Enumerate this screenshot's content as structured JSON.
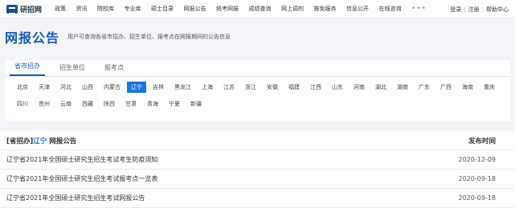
{
  "site": {
    "logo_text": "研招网"
  },
  "nav": {
    "items": [
      "政策",
      "资讯",
      "院校库",
      "专业库",
      "硕士目录",
      "网报公告",
      "统考网报",
      "成绩查询",
      "网上调剂",
      "推免服务",
      "信息公开",
      "在线咨询"
    ],
    "more": "•••"
  },
  "toplinks": {
    "login": "登录",
    "register": "注册",
    "help": "帮助中心",
    "sep": "|"
  },
  "header": {
    "title": "网报公告",
    "desc": "用户可查询各省市招办、招生单位、报考点在网报期间的公告信息"
  },
  "tabs": [
    "省市招办",
    "招生单位",
    "报考点"
  ],
  "provinces": [
    "北京",
    "天津",
    "河北",
    "山西",
    "内蒙古",
    "辽宁",
    "吉林",
    "黑龙江",
    "上海",
    "江苏",
    "浙江",
    "安徽",
    "福建",
    "江西",
    "山东",
    "河南",
    "湖北",
    "湖南",
    "广东",
    "广西",
    "海南",
    "重庆",
    "四川",
    "贵州",
    "云南",
    "西藏",
    "陕西",
    "甘肃",
    "青海",
    "宁夏",
    "新疆"
  ],
  "active_province": "辽宁",
  "list": {
    "title_prefix": "[省招办]",
    "title_region": "辽宁",
    "title_suffix": "网报公告",
    "date_header": "发布时间",
    "rows": [
      {
        "title": "辽宁省2021年全国硕士研究生招生考试考生防疫须知",
        "date": "2020-12-09"
      },
      {
        "title": "辽宁省2021年全国硕士研究生招生考试报考点一览表",
        "date": "2020-09-18"
      },
      {
        "title": "辽宁省2021年全国硕士研究生招生考试网报公告",
        "date": "2020-09-18"
      }
    ]
  }
}
